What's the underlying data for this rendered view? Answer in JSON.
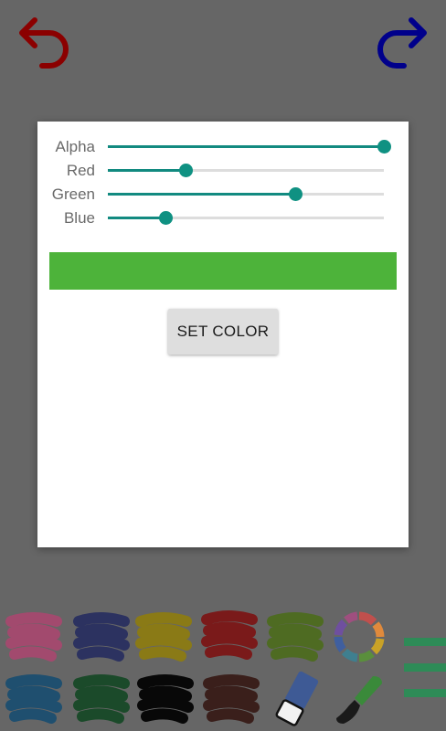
{
  "toolbar": {
    "undo_icon": "undo-arrow-icon",
    "redo_icon": "redo-arrow-icon",
    "undo_color": "#8b0000",
    "redo_color": "#00008b"
  },
  "dialog": {
    "sliders": [
      {
        "label": "Alpha",
        "value": 1.0
      },
      {
        "label": "Red",
        "value": 0.28
      },
      {
        "label": "Green",
        "value": 0.68
      },
      {
        "label": "Blue",
        "value": 0.21
      }
    ],
    "preview_color": "#4db33a",
    "set_color_label": "SET COLOR"
  },
  "palette": {
    "swatches": [
      {
        "name": "pink",
        "color": "#a24a6e"
      },
      {
        "name": "navy",
        "color": "#2c3260"
      },
      {
        "name": "olive-yellow",
        "color": "#8a7a16"
      },
      {
        "name": "dark-red",
        "color": "#7a1a1a"
      },
      {
        "name": "olive-green",
        "color": "#4e6b22"
      },
      {
        "name": "steel-blue",
        "color": "#1f4f6f"
      },
      {
        "name": "dark-green",
        "color": "#1b4a2a"
      },
      {
        "name": "black",
        "color": "#080808"
      },
      {
        "name": "dark-brown",
        "color": "#3a1f1b"
      }
    ],
    "tools": [
      "color-wheel-icon",
      "eraser-icon",
      "paintbrush-icon",
      "menu-icon"
    ]
  }
}
